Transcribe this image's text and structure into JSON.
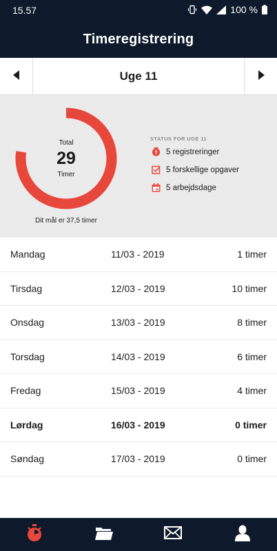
{
  "status_bar": {
    "time": "15.57",
    "battery": "100 %"
  },
  "header": {
    "title": "Timeregistrering"
  },
  "week_nav": {
    "label": "Uge 11"
  },
  "summary": {
    "total_label": "Total",
    "total_value": "29",
    "unit_label": "Timer",
    "goal_text": "Dit mål er 37,5 timer",
    "progress_fraction": 0.773,
    "accent_color": "#e8473c",
    "status_title": "STATUS FOR UGE 11",
    "status_items": [
      {
        "icon": "alert-icon",
        "text": "5 registreringer"
      },
      {
        "icon": "checkbox-icon",
        "text": "5 forskellige opgaver"
      },
      {
        "icon": "calendar-icon",
        "text": "5 arbejdsdage"
      }
    ]
  },
  "days": [
    {
      "name": "Mandag",
      "date": "11/03 - 2019",
      "hours": "1 timer"
    },
    {
      "name": "Tirsdag",
      "date": "12/03 - 2019",
      "hours": "10 timer"
    },
    {
      "name": "Onsdag",
      "date": "13/03 - 2019",
      "hours": "8 timer"
    },
    {
      "name": "Torsdag",
      "date": "14/03 - 2019",
      "hours": "6 timer"
    },
    {
      "name": "Fredag",
      "date": "15/03 - 2019",
      "hours": "4 timer"
    },
    {
      "name": "Lørdag",
      "date": "16/03 - 2019",
      "hours": "0 timer",
      "current": true
    },
    {
      "name": "Søndag",
      "date": "17/03 - 2019",
      "hours": "0 timer"
    }
  ],
  "tabs": [
    {
      "icon": "stopwatch-icon",
      "active": true
    },
    {
      "icon": "folder-icon",
      "active": false
    },
    {
      "icon": "mail-icon",
      "active": false
    },
    {
      "icon": "user-icon",
      "active": false
    }
  ]
}
